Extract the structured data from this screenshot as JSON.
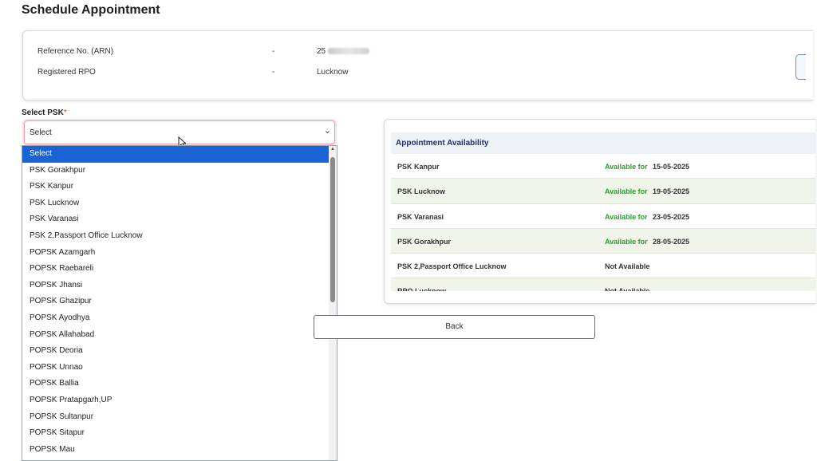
{
  "page": {
    "title": "Schedule Appointment"
  },
  "info": {
    "rows": [
      {
        "label": "Reference No. (ARN)",
        "separator": "-",
        "value": "25"
      },
      {
        "label": "Registered RPO",
        "separator": "-",
        "value": "Lucknow"
      }
    ]
  },
  "select_psk": {
    "label": "Select PSK",
    "required_mark": "*",
    "value": "Select",
    "options": [
      "Select",
      "PSK Gorakhpur",
      "PSK Kanpur",
      "PSK Lucknow",
      "PSK Varanasi",
      "PSK 2,Passport Office Lucknow",
      "POPSK Azamgarh",
      "POPSK Raebareli",
      "POPSK Jhansi",
      "POPSK Ghazipur",
      "POPSK Ayodhya",
      "POPSK Allahabad",
      "POPSK Deoria",
      "POPSK Unnao",
      "POPSK Ballia",
      "POPSK Pratapgarh,UP",
      "POPSK Sultanpur",
      "POPSK Sitapur",
      "POPSK Mau"
    ]
  },
  "availability": {
    "title": "Appointment Availability",
    "rows": [
      {
        "psk": "PSK Kanpur",
        "status": "Available for",
        "date": "15-05-2025"
      },
      {
        "psk": "PSK Lucknow",
        "status": "Available for",
        "date": "19-05-2025"
      },
      {
        "psk": "PSK Varanasi",
        "status": "Available for",
        "date": "23-05-2025"
      },
      {
        "psk": "PSK Gorakhpur",
        "status": "Available for",
        "date": "28-05-2025"
      },
      {
        "psk": "PSK 2,Passport Office Lucknow",
        "status": "Not Available",
        "date": ""
      },
      {
        "psk": "RPO Lucknow",
        "status": "Not Available",
        "date": ""
      }
    ]
  },
  "actions": {
    "back_label": "Back"
  },
  "colors": {
    "selected_option": "#1a64d6",
    "available_text": "#2e9c2e",
    "header_text": "#22316e"
  }
}
